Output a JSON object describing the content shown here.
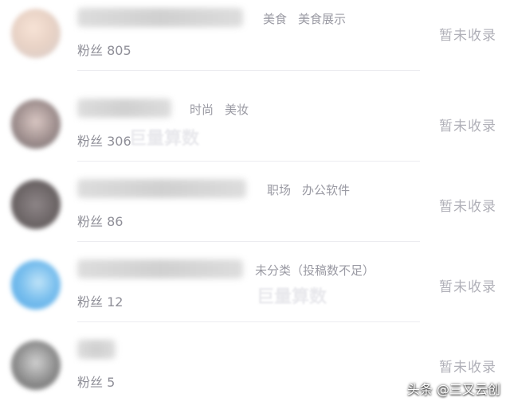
{
  "accounts": [
    {
      "tags": [
        "美食",
        "美食展示"
      ],
      "fans_label": "粉丝 805",
      "status": "暂未收录"
    },
    {
      "tags": [
        "时尚",
        "美妆"
      ],
      "fans_label": "粉丝 306",
      "status": "暂未收录"
    },
    {
      "tags": [
        "职场",
        "办公软件"
      ],
      "fans_label": "粉丝 86",
      "status": "暂未收录"
    },
    {
      "tags": [
        "未分类（投稿数不足）"
      ],
      "fans_label": "粉丝 12",
      "status": "暂未收录"
    },
    {
      "tags": [],
      "fans_label": "粉丝 5",
      "status": "暂未收录"
    }
  ],
  "credit": "头条 @三又云创",
  "watermark": "巨量算数"
}
